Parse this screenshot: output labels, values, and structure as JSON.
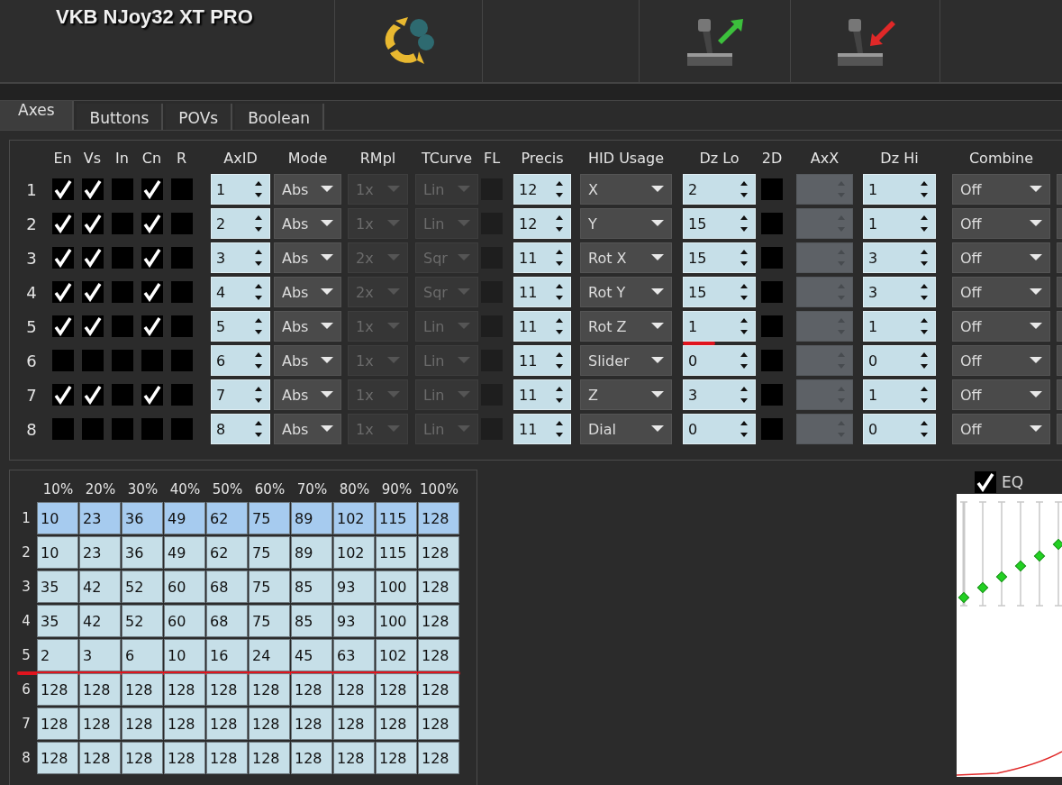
{
  "device_title": "VKB NJoy32 XT PRO",
  "tabs": [
    {
      "label": "Axes",
      "selected": true
    },
    {
      "label": "Buttons",
      "selected": false
    },
    {
      "label": "POVs",
      "selected": false
    },
    {
      "label": "Boolean",
      "selected": false
    }
  ],
  "axes": {
    "headers": {
      "en": "En",
      "vs": "Vs",
      "in": "In",
      "cn": "Cn",
      "r": "R",
      "axid": "AxID",
      "mode": "Mode",
      "rmpl": "RMpl",
      "tcurve": "TCurve",
      "fl": "FL",
      "precis": "Precis",
      "hid_usage": "HID Usage",
      "dz_lo": "Dz Lo",
      "two_d": "2D",
      "axx": "AxX",
      "dz_hi": "Dz Hi",
      "combine": "Combine"
    },
    "rows": [
      {
        "number": "1",
        "en": true,
        "vs": true,
        "in": false,
        "cn": true,
        "r": false,
        "axid": "1",
        "mode": "Abs",
        "rmpl": "1x",
        "tcurve": "Lin",
        "fl": false,
        "precis": "12",
        "hid_usage": "X",
        "dz_lo": "2",
        "dz_lo_underlined": false,
        "two_d": false,
        "dz_hi": "1",
        "combine": "Off"
      },
      {
        "number": "2",
        "en": true,
        "vs": true,
        "in": false,
        "cn": true,
        "r": false,
        "axid": "2",
        "mode": "Abs",
        "rmpl": "1x",
        "tcurve": "Lin",
        "fl": false,
        "precis": "12",
        "hid_usage": "Y",
        "dz_lo": "15",
        "dz_lo_underlined": false,
        "two_d": false,
        "dz_hi": "1",
        "combine": "Off"
      },
      {
        "number": "3",
        "en": true,
        "vs": true,
        "in": false,
        "cn": true,
        "r": false,
        "axid": "3",
        "mode": "Abs",
        "rmpl": "2x",
        "tcurve": "Sqr",
        "fl": false,
        "precis": "11",
        "hid_usage": "Rot X",
        "dz_lo": "15",
        "dz_lo_underlined": false,
        "two_d": false,
        "dz_hi": "3",
        "combine": "Off"
      },
      {
        "number": "4",
        "en": true,
        "vs": true,
        "in": false,
        "cn": true,
        "r": false,
        "axid": "4",
        "mode": "Abs",
        "rmpl": "2x",
        "tcurve": "Sqr",
        "fl": false,
        "precis": "11",
        "hid_usage": "Rot Y",
        "dz_lo": "15",
        "dz_lo_underlined": false,
        "two_d": false,
        "dz_hi": "3",
        "combine": "Off"
      },
      {
        "number": "5",
        "en": true,
        "vs": true,
        "in": false,
        "cn": true,
        "r": false,
        "axid": "5",
        "mode": "Abs",
        "rmpl": "1x",
        "tcurve": "Lin",
        "fl": false,
        "precis": "11",
        "hid_usage": "Rot Z",
        "dz_lo": "1",
        "dz_lo_underlined": true,
        "two_d": false,
        "dz_hi": "1",
        "combine": "Off"
      },
      {
        "number": "6",
        "en": false,
        "vs": false,
        "in": false,
        "cn": false,
        "r": false,
        "axid": "6",
        "mode": "Abs",
        "rmpl": "1x",
        "tcurve": "Lin",
        "fl": false,
        "precis": "11",
        "hid_usage": "Slider",
        "dz_lo": "0",
        "dz_lo_underlined": false,
        "two_d": false,
        "dz_hi": "0",
        "combine": "Off"
      },
      {
        "number": "7",
        "en": true,
        "vs": true,
        "in": false,
        "cn": true,
        "r": false,
        "axid": "7",
        "mode": "Abs",
        "rmpl": "1x",
        "tcurve": "Lin",
        "fl": false,
        "precis": "11",
        "hid_usage": "Z",
        "dz_lo": "3",
        "dz_lo_underlined": false,
        "two_d": false,
        "dz_hi": "1",
        "combine": "Off"
      },
      {
        "number": "8",
        "en": false,
        "vs": false,
        "in": false,
        "cn": false,
        "r": false,
        "axid": "8",
        "mode": "Abs",
        "rmpl": "1x",
        "tcurve": "Lin",
        "fl": false,
        "precis": "11",
        "hid_usage": "Dial",
        "dz_lo": "0",
        "dz_lo_underlined": false,
        "two_d": false,
        "dz_hi": "0",
        "combine": "Off"
      }
    ]
  },
  "curves": {
    "columns": [
      "10%",
      "20%",
      "30%",
      "40%",
      "50%",
      "60%",
      "70%",
      "80%",
      "90%",
      "100%"
    ],
    "rows": [
      {
        "number": "1",
        "selected": true,
        "underlined": false,
        "values": [
          "10",
          "23",
          "36",
          "49",
          "62",
          "75",
          "89",
          "102",
          "115",
          "128"
        ]
      },
      {
        "number": "2",
        "selected": false,
        "underlined": false,
        "values": [
          "10",
          "23",
          "36",
          "49",
          "62",
          "75",
          "89",
          "102",
          "115",
          "128"
        ]
      },
      {
        "number": "3",
        "selected": false,
        "underlined": false,
        "values": [
          "35",
          "42",
          "52",
          "60",
          "68",
          "75",
          "85",
          "93",
          "100",
          "128"
        ]
      },
      {
        "number": "4",
        "selected": false,
        "underlined": false,
        "values": [
          "35",
          "42",
          "52",
          "60",
          "68",
          "75",
          "85",
          "93",
          "100",
          "128"
        ]
      },
      {
        "number": "5",
        "selected": false,
        "underlined": true,
        "values": [
          "2",
          "3",
          "6",
          "10",
          "16",
          "24",
          "45",
          "63",
          "102",
          "128"
        ]
      },
      {
        "number": "6",
        "selected": false,
        "underlined": false,
        "values": [
          "128",
          "128",
          "128",
          "128",
          "128",
          "128",
          "128",
          "128",
          "128",
          "128"
        ]
      },
      {
        "number": "7",
        "selected": false,
        "underlined": false,
        "values": [
          "128",
          "128",
          "128",
          "128",
          "128",
          "128",
          "128",
          "128",
          "128",
          "128"
        ]
      },
      {
        "number": "8",
        "selected": false,
        "underlined": false,
        "values": [
          "128",
          "128",
          "128",
          "128",
          "128",
          "128",
          "128",
          "128",
          "128",
          "128"
        ]
      }
    ]
  },
  "eq": {
    "label": "EQ",
    "checked": true
  }
}
